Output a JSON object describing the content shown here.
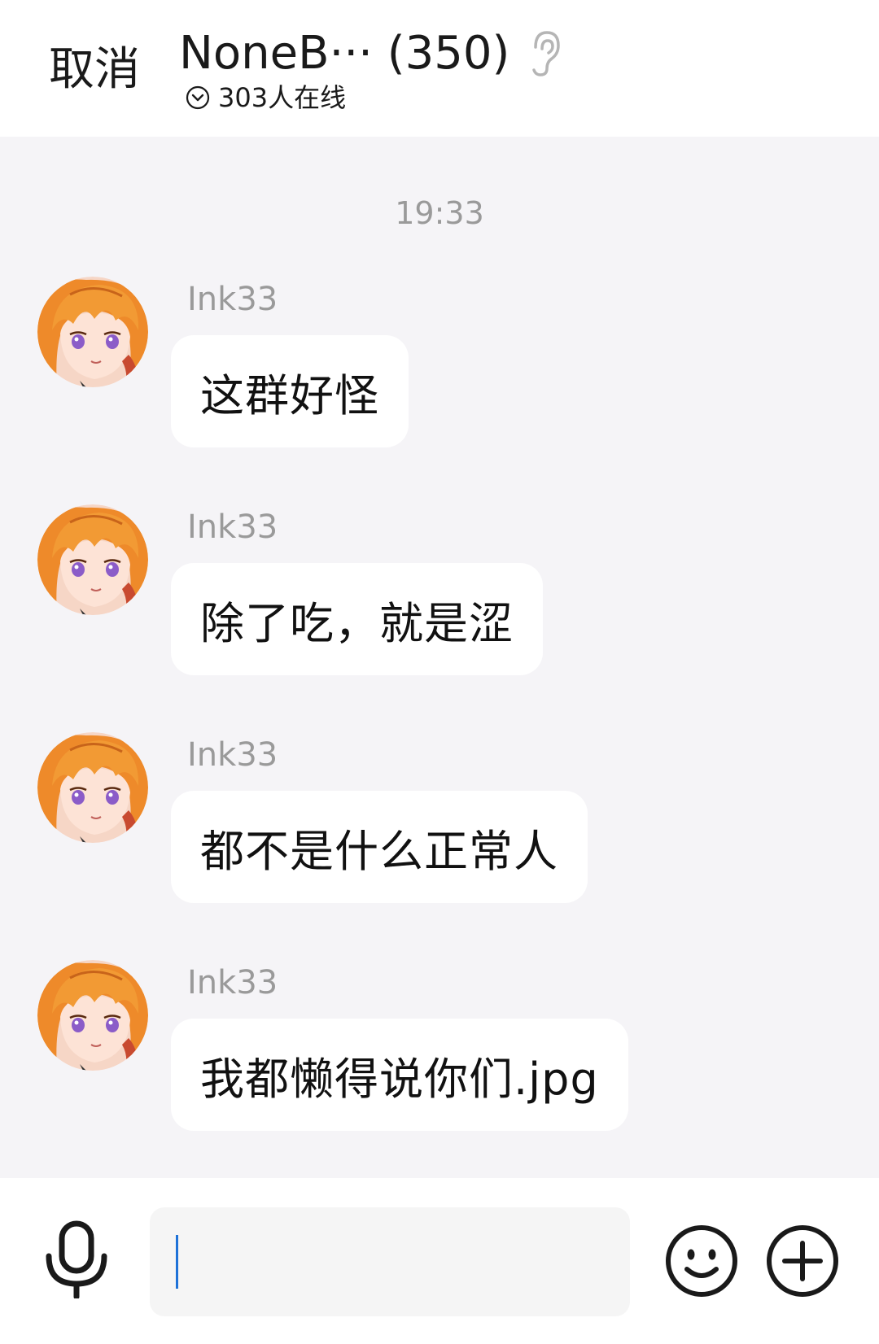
{
  "header": {
    "cancel_label": "取消",
    "group_title": "NoneB··· (350)",
    "online_text": "303人在线"
  },
  "chat": {
    "timestamp": "19:33",
    "messages": [
      {
        "sender": "Ink33",
        "text": "这群好怪"
      },
      {
        "sender": "Ink33",
        "text": "除了吃，就是涩"
      },
      {
        "sender": "Ink33",
        "text": "都不是什么正常人"
      },
      {
        "sender": "Ink33",
        "text": "我都懒得说你们.jpg"
      }
    ]
  },
  "input": {
    "value": ""
  },
  "icons": {
    "ear": "ear-icon",
    "online_status": "chevron-circle-icon",
    "mic": "microphone-icon",
    "emoji": "smiley-icon",
    "plus": "plus-circle-icon"
  },
  "colors": {
    "background": "#f5f4f7",
    "bubble": "#ffffff",
    "caret": "#1e72d8",
    "secondary_text": "#9a9a9a"
  }
}
